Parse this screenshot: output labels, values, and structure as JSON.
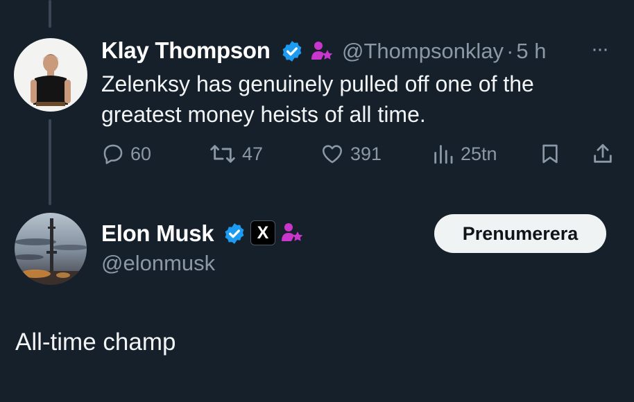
{
  "parent_tweet": {
    "author_name": "Klay Thompson",
    "handle": "@Thompsonklay",
    "time_separator": "·",
    "time": "5 h",
    "more_label": "···",
    "text_line1": "Zelenksy has genuinely pulled off one of the",
    "text_line2": "greatest money heists of all time.",
    "actions": {
      "replies": "60",
      "reposts": "47",
      "likes": "391",
      "views": "25tn"
    },
    "icons": [
      "verified-badge-icon",
      "subscriber-badge-icon",
      "reply-icon",
      "repost-icon",
      "like-icon",
      "views-icon",
      "bookmark-icon",
      "share-icon"
    ]
  },
  "reply_tweet": {
    "author_name": "Elon Musk",
    "handle": "@elonmusk",
    "x_badge": "X",
    "follow_button_label": "Prenumerera",
    "text": "All-time champ",
    "icons": [
      "verified-badge-icon",
      "x-affiliate-badge-icon",
      "subscriber-badge-icon"
    ]
  },
  "colors": {
    "background": "#15202b",
    "verified_blue": "#1d9bf0",
    "subscriber_purple": "#c936cc",
    "secondary_text": "#8b98a5",
    "button_bg": "#eff3f4"
  }
}
